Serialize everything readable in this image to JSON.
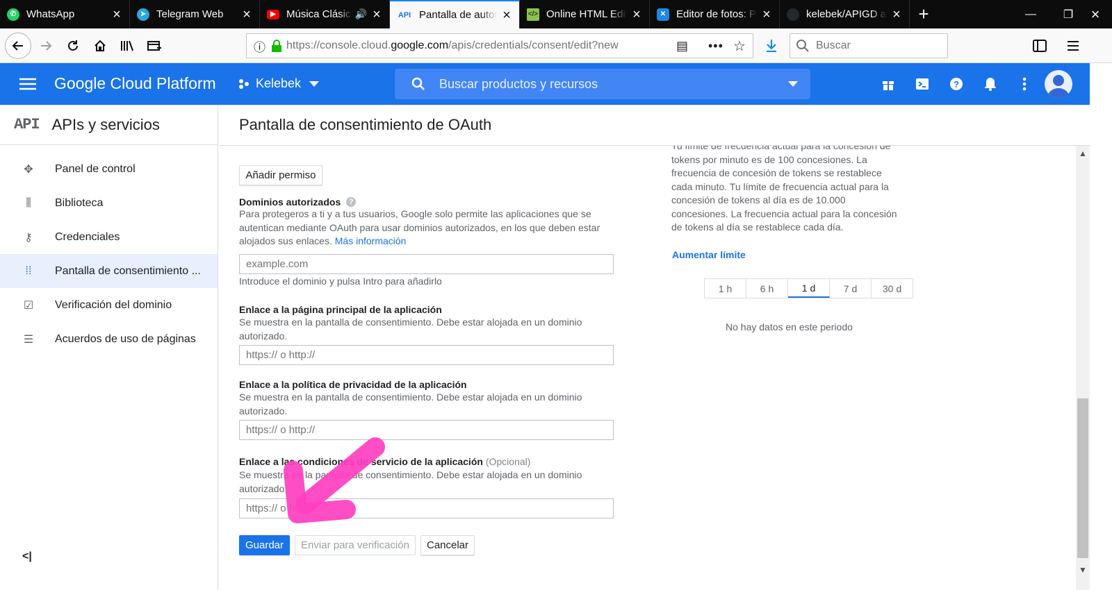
{
  "browser": {
    "tabs": [
      {
        "label": "WhatsApp",
        "icon": "whatsapp-icon",
        "color": "#25d366"
      },
      {
        "label": "Telegram Web",
        "icon": "telegram-icon",
        "color": "#2ca5e0"
      },
      {
        "label": "Música Clásica",
        "icon": "youtube-icon",
        "color": "#ff0000"
      },
      {
        "label": "Pantalla de autorización",
        "icon": "api-icon",
        "color": "#1a73e8"
      },
      {
        "label": "Online HTML Editor",
        "icon": "code-editor-icon",
        "color": "#8bc34a"
      },
      {
        "label": "Editor de fotos: Pixlr",
        "icon": "photo-editor-icon",
        "color": "#1e88e5"
      },
      {
        "label": "kelebek/APIGD at master",
        "icon": "github-icon",
        "color": "#24292e"
      }
    ],
    "url_prefix": "https://console.cloud.",
    "url_domain": "google.com",
    "url_suffix": "/apis/credentials/consent/edit?new",
    "search_placeholder": "Buscar"
  },
  "gcp_header": {
    "product_name": "Google Cloud Platform",
    "project": "Kelebek",
    "search_placeholder": "Buscar productos y recursos"
  },
  "sidebar": {
    "section_badge": "API",
    "section_title": "APIs y servicios",
    "items": [
      {
        "label": "Panel de control",
        "icon": "dashboard-icon"
      },
      {
        "label": "Biblioteca",
        "icon": "library-icon"
      },
      {
        "label": "Credenciales",
        "icon": "key-icon"
      },
      {
        "label": "Pantalla de consentimiento ...",
        "icon": "consent-screen-icon",
        "active": true
      },
      {
        "label": "Verificación del dominio",
        "icon": "domain-verification-icon"
      },
      {
        "label": "Acuerdos de uso de páginas",
        "icon": "page-usage-agreements-icon"
      }
    ],
    "collapse_label": "<|"
  },
  "main": {
    "title": "Pantalla de consentimiento de OAuth",
    "add_permission_label": "Añadir permiso",
    "authorized_domains": {
      "label": "Dominios autorizados",
      "desc_1": "Para protegeros a ti y a tus usuarios, Google solo permite las aplicaciones que se",
      "desc_2": "autentican mediante OAuth para usar dominios autorizados, en los que deben estar",
      "desc_3": "alojados sus enlaces.",
      "more_info": "Más información",
      "placeholder": "example.com",
      "hint": "Introduce el dominio y pulsa Intro para añadirlo"
    },
    "homepage": {
      "label": "Enlace a la página principal de la aplicación",
      "desc_1": "Se muestra en la pantalla de consentimiento. Debe estar alojada en un dominio",
      "desc_2": "autorizado.",
      "placeholder": "https:// o http://"
    },
    "privacy": {
      "label": "Enlace a la política de privacidad de la aplicación",
      "desc_1": "Se muestra en la pantalla de consentimiento. Debe estar alojada en un dominio",
      "desc_2": "autorizado.",
      "placeholder": "https:// o http://"
    },
    "terms": {
      "label": "Enlace a las condiciones de servicio de la aplicación",
      "optional": "(Opcional)",
      "desc_1": "Se muestra en la pantalla de consentimiento. Debe estar alojada en un dominio",
      "desc_2": "autorizado.",
      "placeholder": "https:// o http://"
    },
    "save_label": "Guardar",
    "submit_label": "Enviar para verificación",
    "cancel_label": "Cancelar"
  },
  "right_panel": {
    "info_lines": [
      "Tu límite de frecuencia actual para la concesión de",
      "tokens por minuto es de 100 concesiones. La",
      "frecuencia de concesión de tokens se restablece",
      "cada minuto. Tu límite de frecuencia actual para la",
      "concesión de tokens al día es de 10.000",
      "concesiones. La frecuencia actual para la concesión",
      "de tokens al día se restablece cada día."
    ],
    "increase_limit": "Aumentar límite",
    "ranges": [
      "1 h",
      "6 h",
      "1 d",
      "7 d",
      "30 d"
    ],
    "selected_range": "1 d",
    "no_data": "No hay datos en este periodo"
  },
  "colors": {
    "accent": "#1a73e8",
    "annotation_arrow": "#ff3fc0"
  }
}
